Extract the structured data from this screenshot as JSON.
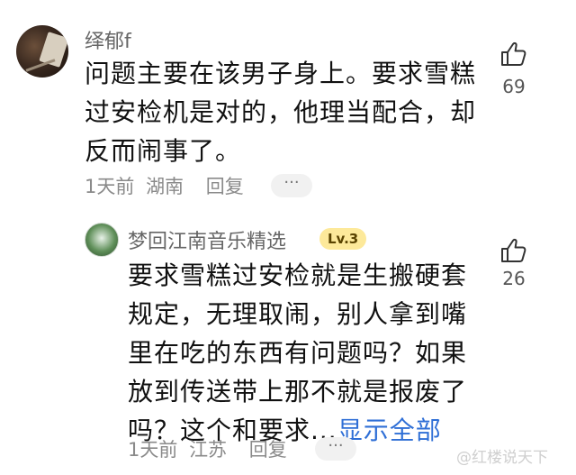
{
  "comments": [
    {
      "username": "绎郁f",
      "text_lines": [
        "问题主要在该男子身上。要求雪糕",
        "过安检机是对的，他理当配合，却",
        "反而闹事了。"
      ],
      "time": "1天前",
      "location": "湖南",
      "reply_label": "回复",
      "more_label": "···",
      "like_count": "69"
    },
    {
      "username": "梦回江南音乐精选",
      "level_badge": "Lv.3",
      "text_lines": [
        "要求雪糕过安检就是生搬硬套",
        "规定，无理取闹，别人拿到嘴",
        "里在吃的东西有问题吗？如果",
        "放到传送带上那不就是报废了",
        "吗？这个和要求..."
      ],
      "show_all_label": "显示全部",
      "time": "1天前",
      "location": "江苏",
      "reply_label": "回复",
      "more_label": "···",
      "like_count": "26"
    }
  ],
  "watermark": "@红楼说天下"
}
